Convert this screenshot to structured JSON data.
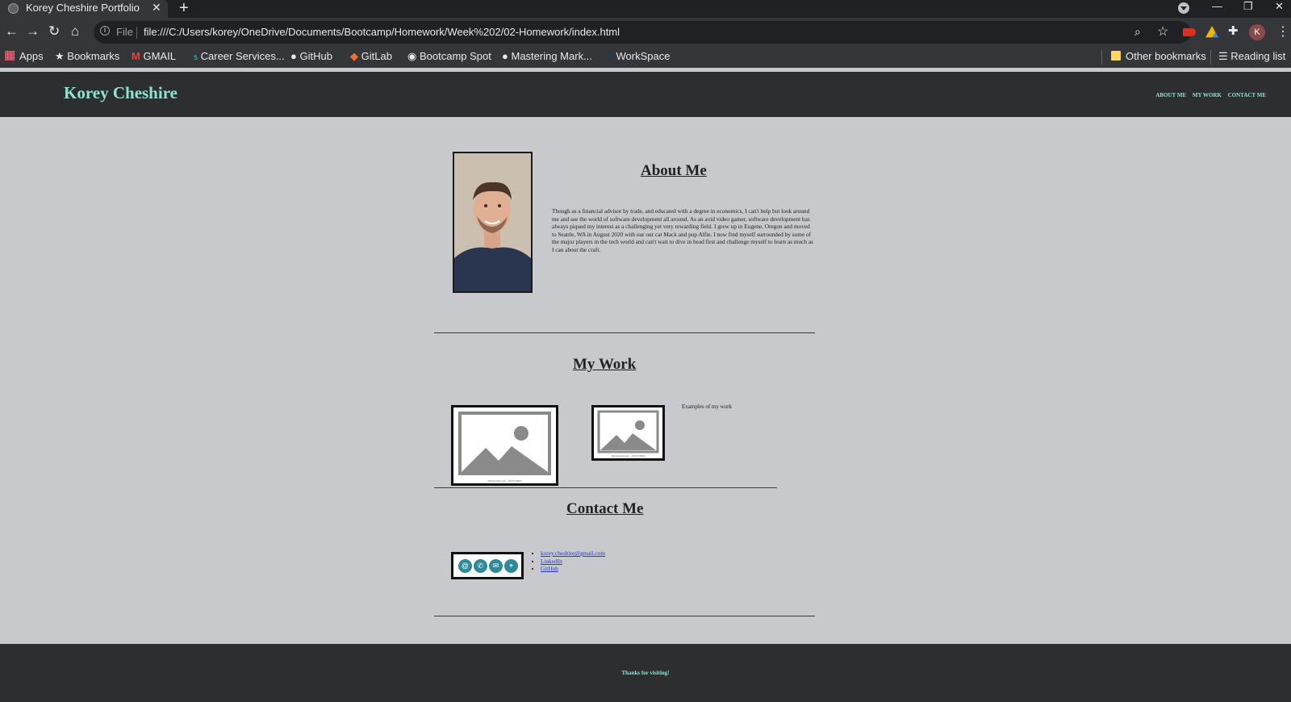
{
  "browser": {
    "tab_title": "Korey Cheshire Portfolio",
    "file_label": "File",
    "url": "file:///C:/Users/korey/OneDrive/Documents/Bootcamp/Homework/Week%202/02-Homework/index.html",
    "profile_initial": "K",
    "bookmarks": [
      "Apps",
      "Bookmarks",
      "GMAIL",
      "Career Services...",
      "GitHub",
      "GitLab",
      "Bootcamp Spot",
      "Mastering Mark...",
      "WorkSpace"
    ],
    "other_bookmarks": "Other bookmarks",
    "reading_list": "Reading list"
  },
  "site": {
    "name": "Korey Cheshire",
    "nav": [
      "ABOUT ME",
      "MY WORK",
      "CONTACT ME"
    ],
    "about": {
      "title": "About Me",
      "text": "Though as a financial advisor by trade, and educated with a degree in economics, I can't help but look around me and see the world of software development all around. As an avid video gamer, software development has always piqued my interest as a challenging yet very rewarding field. I grew up in Eugene, Oregon and moved to Seattle, WA in August 2020 with our our cat Mack and pup Alfie. I now find myself surrounded by some of the major players in the tech world and can't wait to dive in head first and challenge myself to learn as much as I can about the craft."
    },
    "work": {
      "title": "My Work",
      "caption": "Examples of my work",
      "image_credit": "shutterstock.com · 1037719204"
    },
    "contact": {
      "title": "Contact Me",
      "links": [
        "korey.cheshire@gmail.com",
        "LinkedIn",
        "GitHub"
      ]
    },
    "footer": "Thanks for visiting!"
  },
  "colors": {
    "accent": "#8ee3d1",
    "header_bg": "#2d2e2f",
    "page_bg": "#c8c9cd",
    "link": "#2a2ee8"
  }
}
